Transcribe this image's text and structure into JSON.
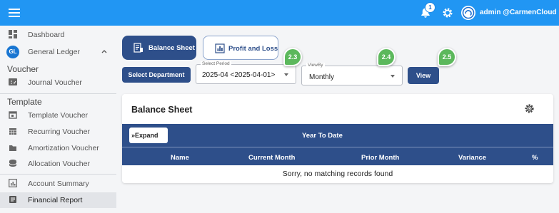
{
  "topbar": {
    "notification_count": "1",
    "user_label": "admin @CarmenCloud",
    "bg_color": "#2196f3"
  },
  "sidebar": {
    "dashboard": "Dashboard",
    "gl_badge": "GL",
    "general_ledger": "General Ledger",
    "voucher_section": "Voucher",
    "journal_voucher": "Journal Voucher",
    "template_section": "Template",
    "template_voucher": "Template Voucher",
    "recurring_voucher": "Recurring Voucher",
    "amortization_voucher": "Amortization Voucher",
    "allocation_voucher": "Allocation Voucher",
    "account_summary": "Account Summary",
    "financial_report": "Financial Report"
  },
  "tabs": {
    "balance_sheet": "Balance Sheet",
    "profit_and_loss": "Profit and Loss"
  },
  "controls": {
    "select_department": "Select Department",
    "period_label": "Select Period",
    "period_value": "2025-04 <2025-04-01>",
    "viewby_label": "ViewBy",
    "viewby_value": "Monthly",
    "view_button": "View"
  },
  "callouts": {
    "c1": "2.3",
    "c2": "2.4",
    "c3": "2.5"
  },
  "report": {
    "title": "Balance Sheet",
    "expand": "Expand",
    "group_header": "Year To Date",
    "columns": [
      "Name",
      "Current Month",
      "Prior Month",
      "Variance",
      "%"
    ],
    "empty_message": "Sorry, no matching records found"
  },
  "colors": {
    "accent": "#2e4f8a",
    "callout": "#5cb85c"
  }
}
